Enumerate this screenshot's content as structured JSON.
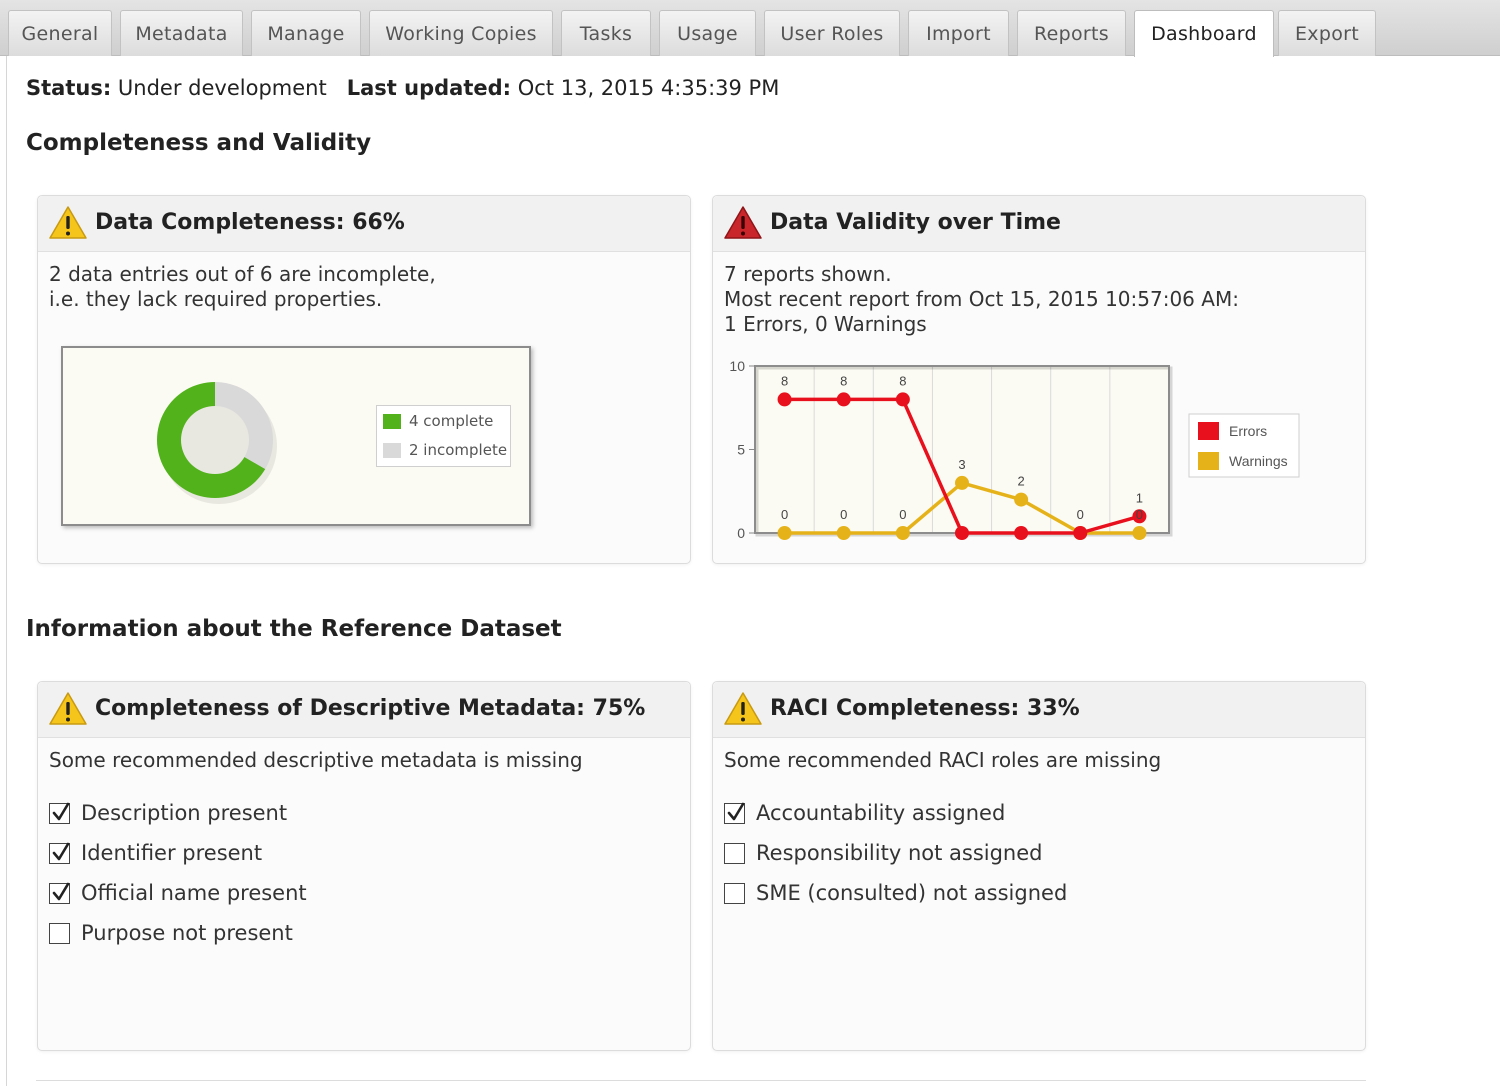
{
  "tabs": [
    {
      "label": "General",
      "active": false
    },
    {
      "label": "Metadata",
      "active": false
    },
    {
      "label": "Manage",
      "active": false
    },
    {
      "label": "Working Copies",
      "active": false
    },
    {
      "label": "Tasks",
      "active": false
    },
    {
      "label": "Usage",
      "active": false
    },
    {
      "label": "User Roles",
      "active": false
    },
    {
      "label": "Import",
      "active": false
    },
    {
      "label": "Reports",
      "active": false
    },
    {
      "label": "Dashboard",
      "active": true
    },
    {
      "label": "Export",
      "active": false
    }
  ],
  "status": {
    "status_label": "Status:",
    "status_value": "Under development",
    "updated_label": "Last updated:",
    "updated_value": "Oct 13, 2015 4:35:39 PM"
  },
  "sections": {
    "completeness": "Completeness and Validity",
    "reference": "Information about the Reference Dataset"
  },
  "data_completeness": {
    "title": "Data Completeness: 66%",
    "line1": "2 data entries out of 6 are incomplete,",
    "line2": "i.e. they lack required properties.",
    "legend_complete": "4 complete",
    "legend_incomplete": "2 incomplete"
  },
  "data_validity": {
    "title": "Data Validity over Time",
    "line1": "7 reports shown.",
    "line2": "Most recent report from Oct 15, 2015 10:57:06 AM:",
    "line3": "1 Errors, 0 Warnings"
  },
  "descriptive_metadata": {
    "title": "Completeness of Descriptive Metadata: 75%",
    "subtitle": "Some recommended descriptive metadata is missing",
    "items": [
      {
        "label": "Description present",
        "checked": true
      },
      {
        "label": "Identifier present",
        "checked": true
      },
      {
        "label": "Official name present",
        "checked": true
      },
      {
        "label": "Purpose not present",
        "checked": false
      }
    ]
  },
  "raci": {
    "title": "RACI Completeness: 33%",
    "subtitle": "Some recommended RACI roles are missing",
    "items": [
      {
        "label": "Accountability assigned",
        "checked": true
      },
      {
        "label": "Responsibility not assigned",
        "checked": false
      },
      {
        "label": "SME (consulted) not assigned",
        "checked": false
      }
    ]
  },
  "icons": {
    "warning": "warning-triangle-icon",
    "error": "error-triangle-icon",
    "checkbox_checked": "checkbox-checked-icon",
    "checkbox_empty": "checkbox-empty-icon"
  },
  "colors": {
    "warning_yellow": "#f5c51b",
    "error_red": "#c8262b",
    "complete_green": "#52b21c",
    "incomplete_gray": "#d9d9d9",
    "errors_series": "#e8101c",
    "warnings_series": "#e6b21a"
  },
  "chart_data": [
    {
      "type": "pie",
      "variant": "donut",
      "categories": [
        "4 complete",
        "2 incomplete"
      ],
      "values": [
        4,
        2
      ],
      "legend": "right"
    },
    {
      "type": "line",
      "x": [
        1,
        2,
        3,
        4,
        5,
        6,
        7
      ],
      "series": [
        {
          "name": "Errors",
          "values": [
            8,
            8,
            8,
            0,
            0,
            0,
            1
          ]
        },
        {
          "name": "Warnings",
          "values": [
            0,
            0,
            0,
            3,
            2,
            0,
            0
          ]
        }
      ],
      "ylim": [
        0,
        10
      ],
      "yticks": [
        "0",
        "5",
        "10"
      ],
      "grid": true,
      "legend": "right"
    }
  ]
}
